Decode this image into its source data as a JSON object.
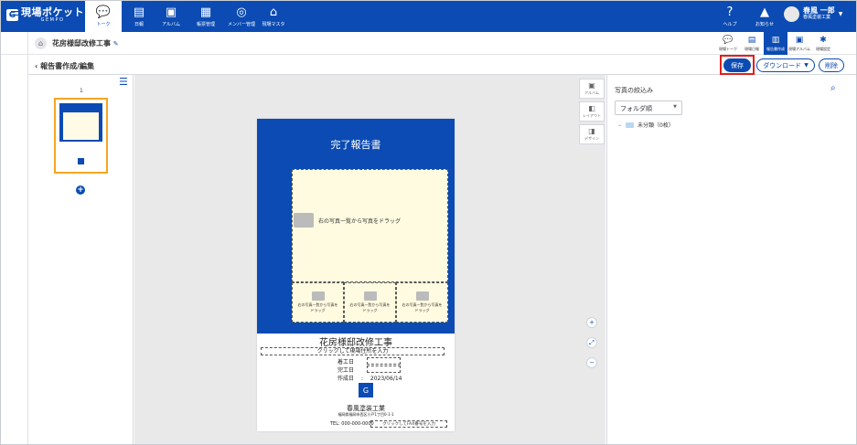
{
  "nav": {
    "logo_main": "現場ポケット",
    "logo_sub": "GEMPO",
    "items": [
      {
        "icon": "💬",
        "label": "トーク"
      },
      {
        "icon": "▤",
        "label": "日報"
      },
      {
        "icon": "▣",
        "label": "アルバム"
      },
      {
        "icon": "▦",
        "label": "帳票管理"
      },
      {
        "icon": "◎",
        "label": "メンバー管理"
      },
      {
        "icon": "⌂",
        "label": "現場マスタ"
      }
    ],
    "help_label": "ヘルプ",
    "notify_label": "お知らせ",
    "user_name": "春風 一郎",
    "user_company": "春風塗装工業"
  },
  "subnav": {
    "project_title": "花房様邸改修工事",
    "tabs": [
      {
        "icon": "💬",
        "label": "現場トーク"
      },
      {
        "icon": "▤",
        "label": "現場日報"
      },
      {
        "icon": "▥",
        "label": "報告書作成"
      },
      {
        "icon": "▣",
        "label": "現場アルバム"
      },
      {
        "icon": "✱",
        "label": "現場設定"
      }
    ]
  },
  "toolbar": {
    "back_label": "報告書作成/編集",
    "save_label": "保存",
    "download_label": "ダウンロード",
    "delete_label": "削除"
  },
  "thumbs": {
    "page_number": "1"
  },
  "tools": [
    {
      "icon": "▣",
      "label": "アルバム"
    },
    {
      "icon": "◧",
      "label": "レイアウト"
    },
    {
      "icon": "◨",
      "label": "デザイン"
    }
  ],
  "report": {
    "title": "完了報告書",
    "main_drop_text": "右の写真一覧から写真をドラッグ",
    "small_drop_text": "右の写真一覧から写真をドラッグ",
    "project_name": "花房様邸改修工事",
    "address_placeholder": "クリックして現場住所を入力",
    "start_label": "着工日",
    "end_label": "完工日",
    "created_label": "作成日",
    "created_value": "2023/06/14",
    "company_name": "春風塗装工業",
    "company_address": "福岡県福岡市西区小戸1丁目0-1-1",
    "tel": "TEL: 000-000-0000",
    "fax_placeholder": "クリックしてFAX番号を入力"
  },
  "photo_panel": {
    "title": "写真の絞込み",
    "select_value": "フォルダ順",
    "folder_label": "未分類（0枚）"
  },
  "colors": {
    "primary": "#0b4bb3",
    "highlight": "#e0201c",
    "thumb_border": "#f5a623"
  }
}
